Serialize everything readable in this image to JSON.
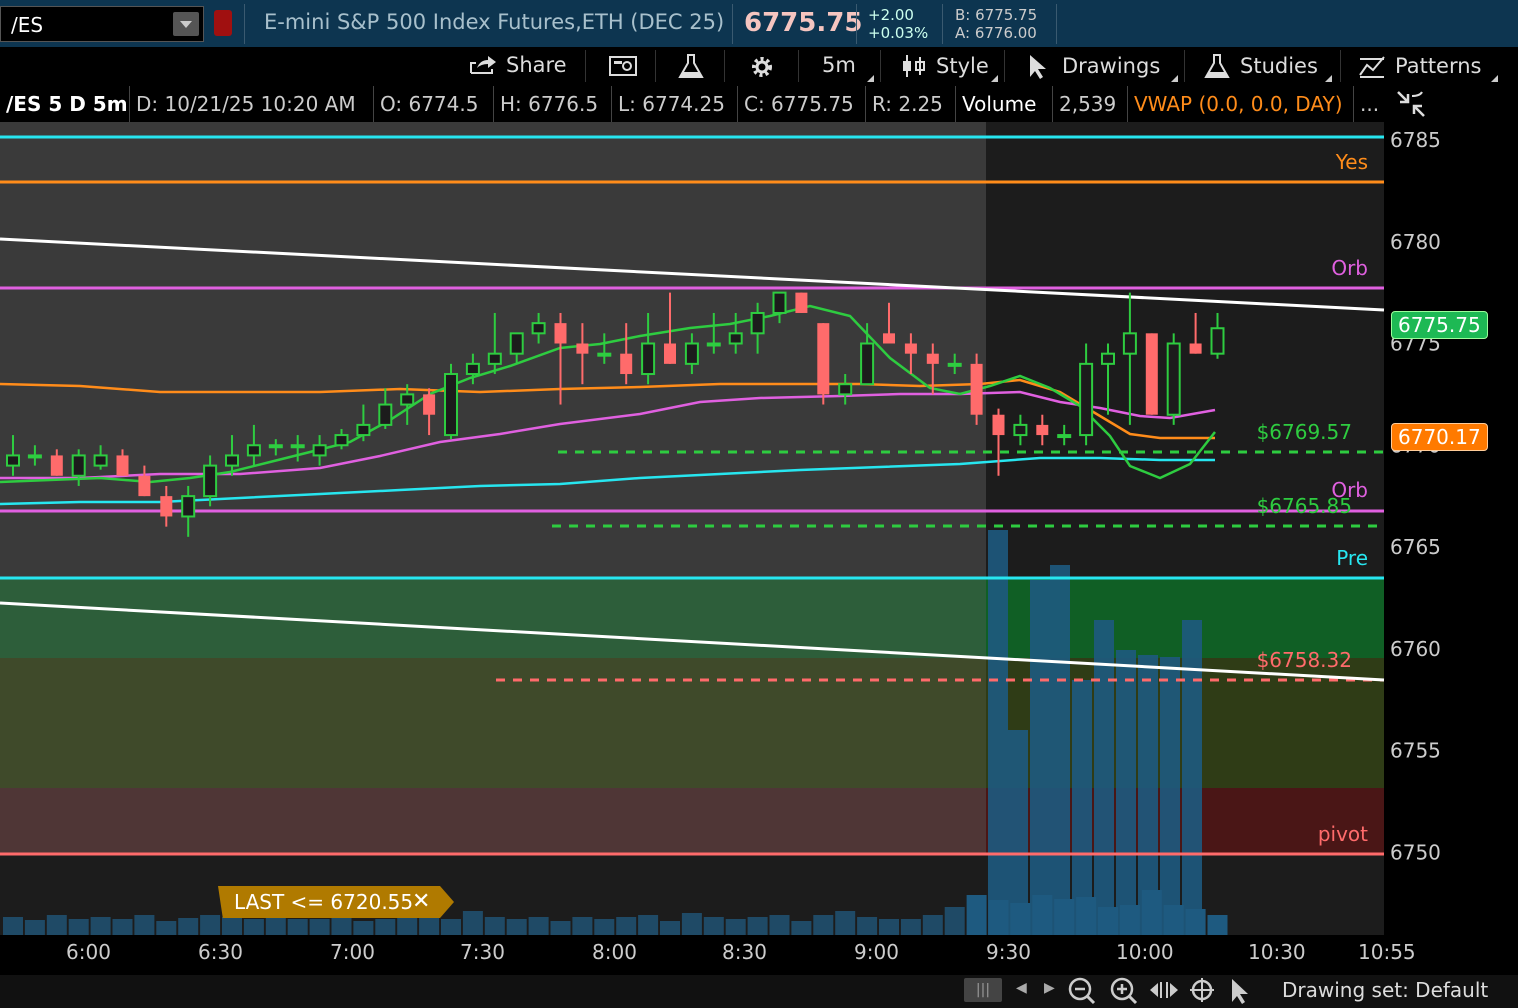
{
  "header": {
    "symbol": "/ES",
    "description": "E-mini S&P 500 Index Futures,ETH (DEC 25)",
    "last": "6775.75",
    "change": "+2.00",
    "change_pct": "+0.03%",
    "bid": "B: 6775.75",
    "ask": "A: 6776.00"
  },
  "toolbar": {
    "share": "Share",
    "timeframe": "5m",
    "style": "Style",
    "drawings": "Drawings",
    "studies": "Studies",
    "patterns": "Patterns"
  },
  "info": {
    "chart_id": "/ES 5 D 5m",
    "date": "D: 10/21/25 10:20 AM",
    "open": "O: 6774.5",
    "high": "H: 6776.5",
    "low": "L: 6774.25",
    "close": "C: 6775.75",
    "range": "R: 2.25",
    "volume_label": "Volume",
    "volume_value": "2,539",
    "vwap": "VWAP (0.0, 0.0, DAY)",
    "more": "..."
  },
  "levels": {
    "yes": "Yes",
    "orb_top": "Orb",
    "orb_bottom": "Orb",
    "pre": "Pre",
    "pivot": "pivot",
    "green1": "$6769.57",
    "green2": "$6765.85",
    "red1": "$6758.32"
  },
  "price_tags": {
    "last": "6775.75",
    "vwap": "6770.17"
  },
  "alert": {
    "text": "LAST <= 6720.55"
  },
  "y_ticks": [
    "6785",
    "6780",
    "6775",
    "6770",
    "6765",
    "6760",
    "6755",
    "6750"
  ],
  "x_ticks": [
    "6:00",
    "6:30",
    "7:00",
    "7:30",
    "8:00",
    "8:30",
    "9:00",
    "9:30",
    "10:00",
    "10:30",
    "10:55"
  ],
  "footer": {
    "drawing_set": "Drawing set: Default"
  },
  "colors": {
    "up": "#2ecc40",
    "down": "#ff6b6b",
    "cyan": "#27e6f0",
    "orange": "#ff8c1a",
    "magenta": "#e060e0"
  },
  "chart_data": {
    "type": "candlestick",
    "ylim": [
      6746,
      6786
    ],
    "x": [
      "5:45",
      "5:50",
      "5:55",
      "6:00",
      "6:05",
      "6:10",
      "6:15",
      "6:20",
      "6:25",
      "6:30",
      "6:35",
      "6:40",
      "6:45",
      "6:50",
      "6:55",
      "7:00",
      "7:05",
      "7:10",
      "7:15",
      "7:20",
      "7:25",
      "7:30",
      "7:35",
      "7:40",
      "7:45",
      "7:50",
      "7:55",
      "8:00",
      "8:05",
      "8:10",
      "8:15",
      "8:20",
      "8:25",
      "8:30",
      "8:35",
      "8:40",
      "8:45",
      "8:50",
      "8:55",
      "9:00",
      "9:05",
      "9:10",
      "9:15",
      "9:20",
      "9:25",
      "9:30",
      "9:35",
      "9:40",
      "9:45",
      "9:50",
      "9:55",
      "10:00",
      "10:05",
      "10:10",
      "10:15",
      "10:20"
    ],
    "ohlc": [
      [
        6769.0,
        6770.5,
        6768.5,
        6769.5
      ],
      [
        6769.5,
        6770,
        6769,
        6769.5
      ],
      [
        6769.5,
        6769.8,
        6768.5,
        6768.5
      ],
      [
        6768.5,
        6769.8,
        6768,
        6769.5
      ],
      [
        6769,
        6770,
        6768.8,
        6769.5
      ],
      [
        6769.5,
        6769.8,
        6768.5,
        6768.5
      ],
      [
        6768.5,
        6769,
        6767.5,
        6767.5
      ],
      [
        6767.5,
        6768,
        6766,
        6766.5
      ],
      [
        6766.5,
        6768,
        6765.5,
        6767.5
      ],
      [
        6767.5,
        6769.5,
        6767,
        6769
      ],
      [
        6769,
        6770.5,
        6768.5,
        6769.5
      ],
      [
        6769.5,
        6771,
        6769,
        6770
      ],
      [
        6770,
        6770.3,
        6769.5,
        6770
      ],
      [
        6770,
        6770.5,
        6769.2,
        6770
      ],
      [
        6769.5,
        6770.5,
        6769,
        6770
      ],
      [
        6770,
        6770.8,
        6769.8,
        6770.5
      ],
      [
        6770.5,
        6772,
        6770.2,
        6771
      ],
      [
        6771,
        6772.8,
        6770.8,
        6772
      ],
      [
        6772,
        6773,
        6771,
        6772.5
      ],
      [
        6772.5,
        6772.8,
        6770.5,
        6771.5
      ],
      [
        6770.5,
        6774,
        6770.3,
        6773.5
      ],
      [
        6773.5,
        6774.5,
        6773,
        6774
      ],
      [
        6774,
        6776.5,
        6773.5,
        6774.5
      ],
      [
        6774.5,
        6775.5,
        6774,
        6775.5
      ],
      [
        6775.5,
        6776.5,
        6775,
        6776
      ],
      [
        6776,
        6776.5,
        6772,
        6775
      ],
      [
        6775,
        6776,
        6773,
        6774.5
      ],
      [
        6774.5,
        6775.5,
        6774,
        6774.5
      ],
      [
        6774.5,
        6776,
        6773,
        6773.5
      ],
      [
        6773.5,
        6776.5,
        6773,
        6775
      ],
      [
        6775,
        6777.5,
        6774,
        6774
      ],
      [
        6774,
        6775.5,
        6773.5,
        6775
      ],
      [
        6775,
        6776.5,
        6774.5,
        6775
      ],
      [
        6775,
        6776.5,
        6774.5,
        6775.5
      ],
      [
        6775.5,
        6777,
        6774.5,
        6776.5
      ],
      [
        6776.5,
        6777.5,
        6776,
        6777.5
      ],
      [
        6777.5,
        6777.5,
        6776.5,
        6776.5
      ],
      [
        6776,
        6776,
        6772,
        6772.5
      ],
      [
        6772.5,
        6773.5,
        6772,
        6773
      ],
      [
        6773,
        6776,
        6773,
        6775
      ],
      [
        6775.5,
        6777,
        6775,
        6775
      ],
      [
        6775,
        6775.5,
        6773.5,
        6774.5
      ],
      [
        6774.5,
        6775,
        6772.5,
        6774
      ],
      [
        6774,
        6774.5,
        6773.5,
        6774
      ],
      [
        6774,
        6774.5,
        6771,
        6771.5
      ],
      [
        6771.5,
        6771.8,
        6768.5,
        6770.5
      ],
      [
        6770.5,
        6771.5,
        6770,
        6771
      ],
      [
        6771,
        6771.5,
        6770,
        6770.5
      ],
      [
        6770.5,
        6771,
        6770,
        6770.5
      ],
      [
        6770.5,
        6775,
        6770,
        6774
      ],
      [
        6774,
        6775,
        6771.5,
        6774.5
      ],
      [
        6774.5,
        6777.5,
        6771,
        6775.5
      ],
      [
        6775.5,
        6775.5,
        6771.5,
        6771.5
      ],
      [
        6771.5,
        6775.5,
        6771,
        6775
      ],
      [
        6775,
        6776.5,
        6774.5,
        6774.5
      ],
      [
        6774.5,
        6776.5,
        6774.25,
        6775.75
      ]
    ]
  }
}
